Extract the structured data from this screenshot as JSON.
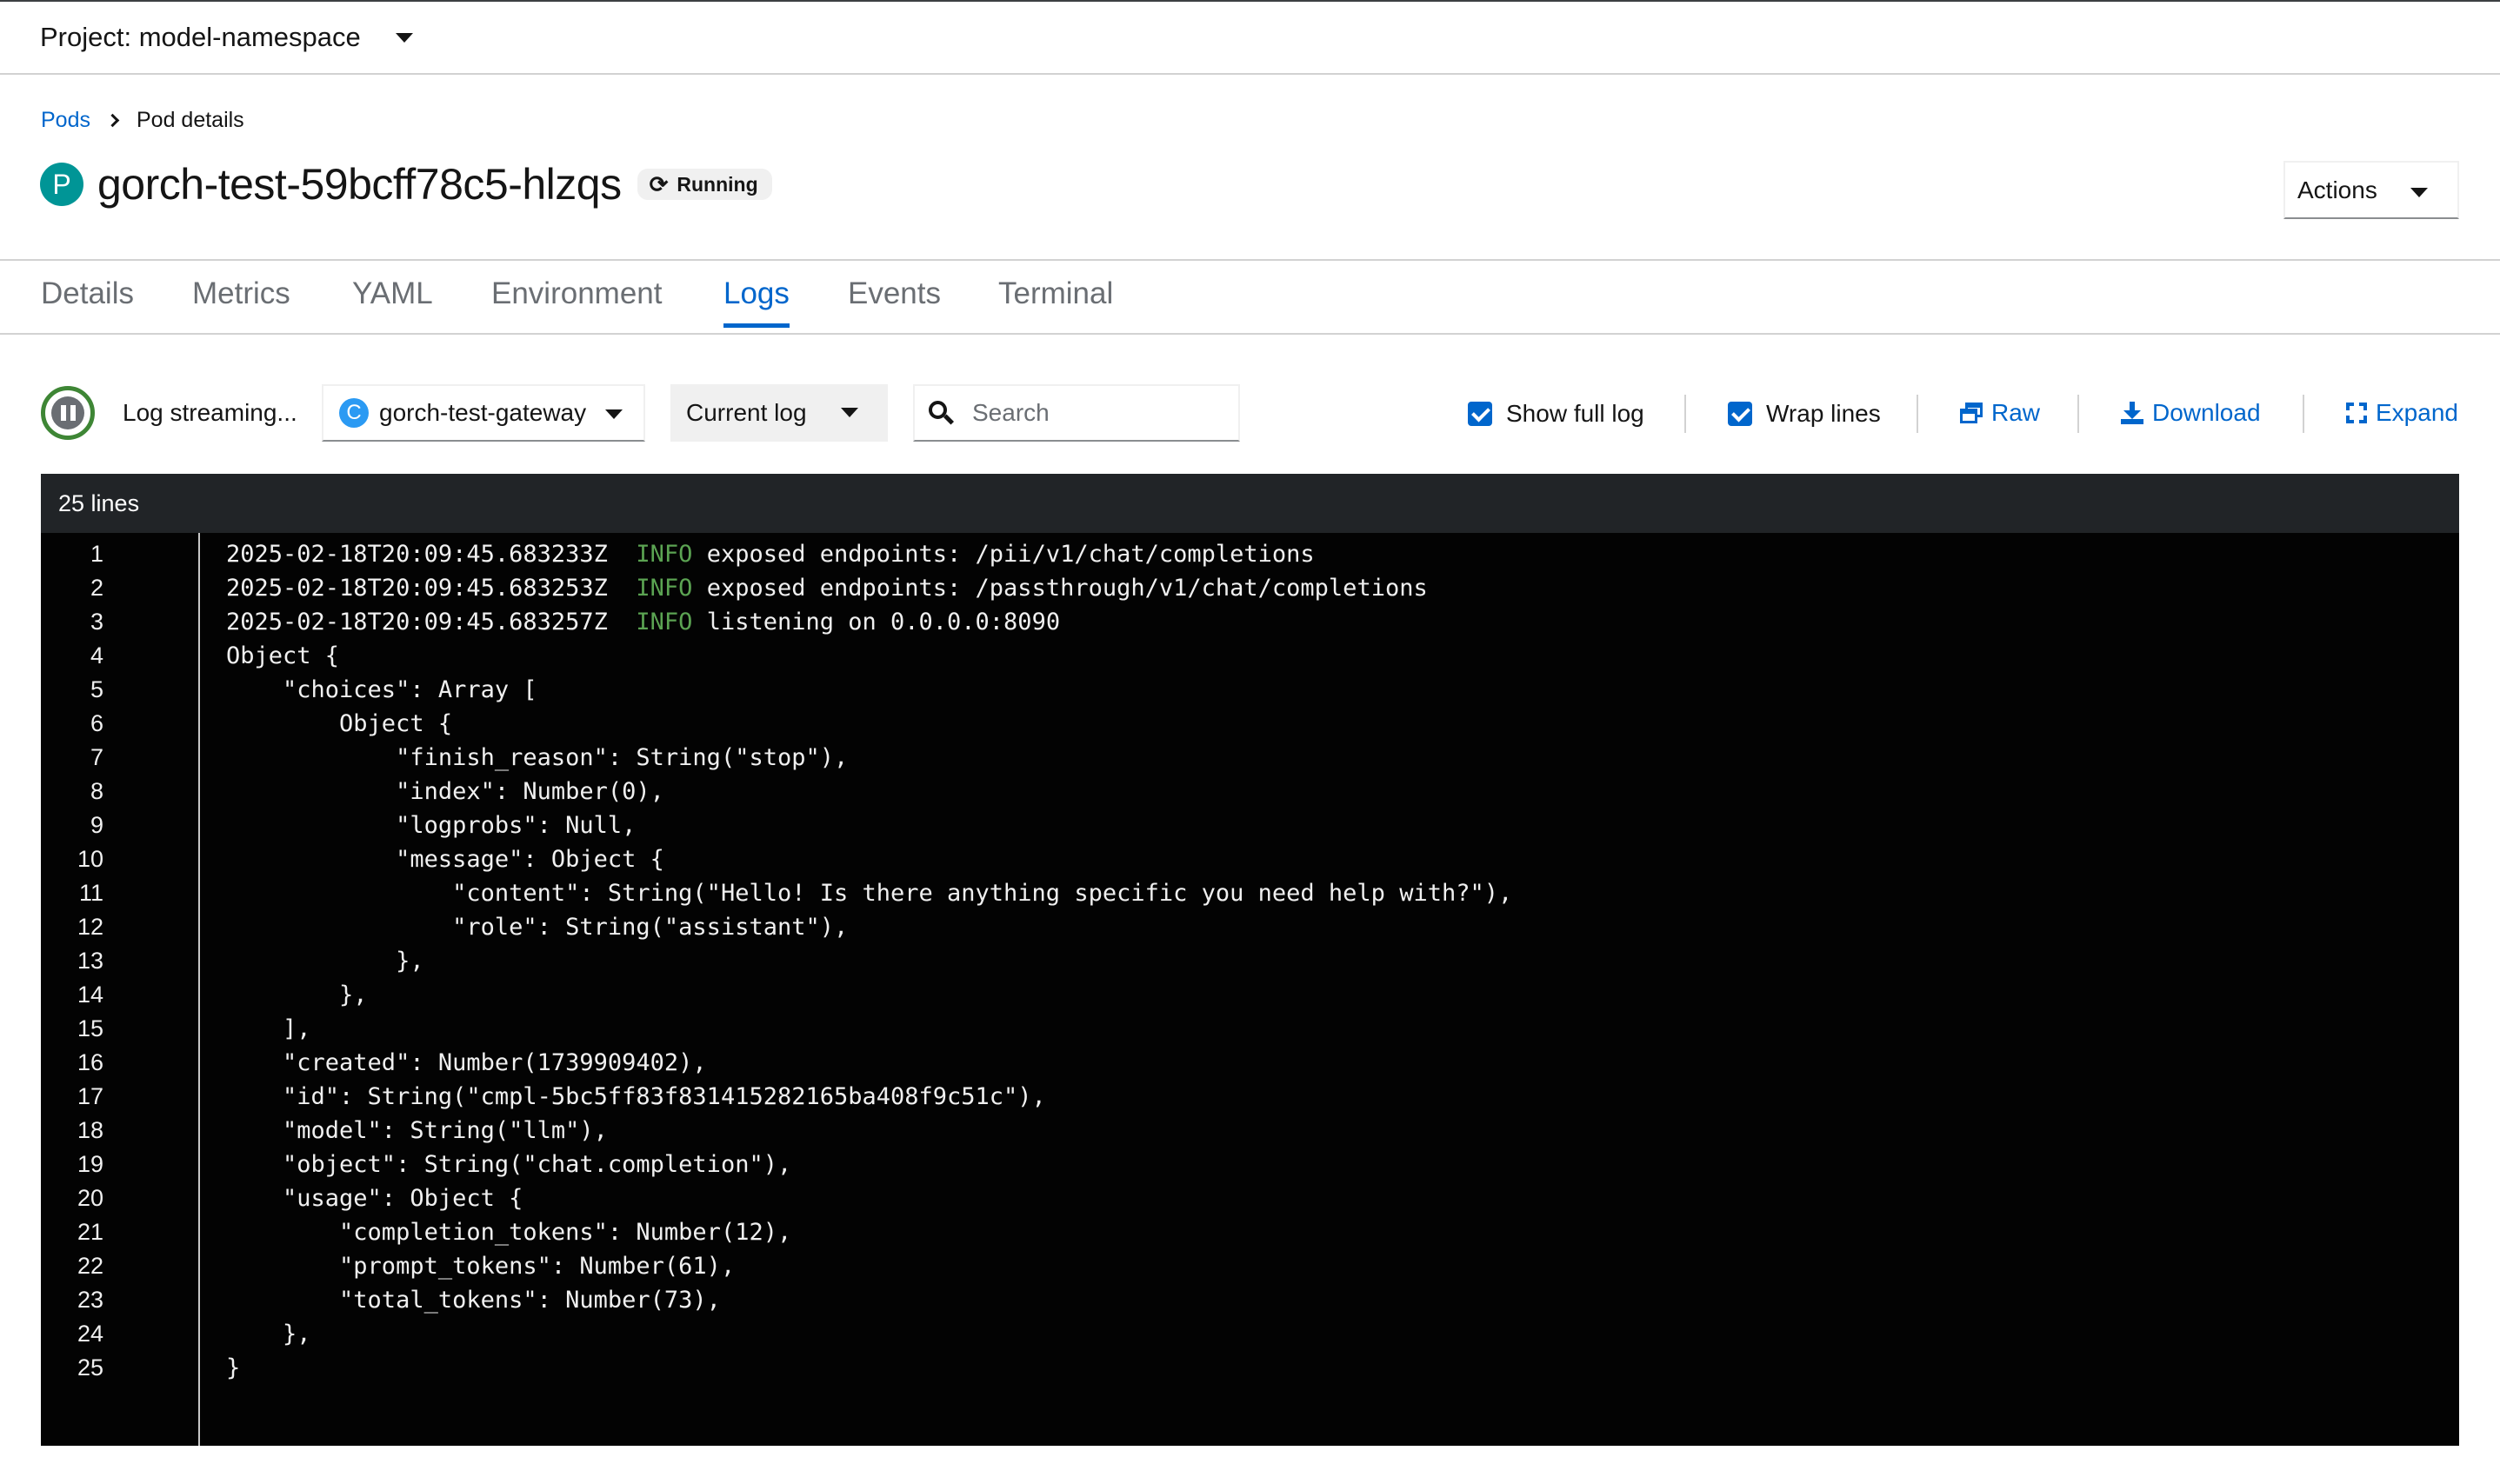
{
  "project": {
    "label": "Project: model-namespace"
  },
  "breadcrumb": {
    "parent": "Pods",
    "current": "Pod details"
  },
  "pod": {
    "badge": "P",
    "name": "gorch-test-59bcff78c5-hlzqs",
    "status": "Running"
  },
  "actions": {
    "label": "Actions"
  },
  "tabs": [
    {
      "label": "Details"
    },
    {
      "label": "Metrics"
    },
    {
      "label": "YAML"
    },
    {
      "label": "Environment"
    },
    {
      "label": "Logs",
      "active": true
    },
    {
      "label": "Events"
    },
    {
      "label": "Terminal"
    }
  ],
  "toolbar": {
    "streaming_label": "Log streaming...",
    "container_badge": "C",
    "container": "gorch-test-gateway",
    "log_type": "Current log",
    "search_placeholder": "Search",
    "show_full_log": "Show full log",
    "wrap_lines": "Wrap lines",
    "raw": "Raw",
    "download": "Download",
    "expand": "Expand"
  },
  "log": {
    "line_count": "25 lines",
    "lines": [
      {
        "n": "1",
        "ts": "2025-02-18T20:09:45.683233Z  ",
        "level": "INFO",
        "text": " exposed endpoints: /pii/v1/chat/completions"
      },
      {
        "n": "2",
        "ts": "2025-02-18T20:09:45.683253Z  ",
        "level": "INFO",
        "text": " exposed endpoints: /passthrough/v1/chat/completions"
      },
      {
        "n": "3",
        "ts": "2025-02-18T20:09:45.683257Z  ",
        "level": "INFO",
        "text": " listening on 0.0.0.0:8090"
      },
      {
        "n": "4",
        "text": "Object {"
      },
      {
        "n": "5",
        "text": "    \"choices\": Array ["
      },
      {
        "n": "6",
        "text": "        Object {"
      },
      {
        "n": "7",
        "text": "            \"finish_reason\": String(\"stop\"),"
      },
      {
        "n": "8",
        "text": "            \"index\": Number(0),"
      },
      {
        "n": "9",
        "text": "            \"logprobs\": Null,"
      },
      {
        "n": "10",
        "text": "            \"message\": Object {"
      },
      {
        "n": "11",
        "text": "                \"content\": String(\"Hello! Is there anything specific you need help with?\"),"
      },
      {
        "n": "12",
        "text": "                \"role\": String(\"assistant\"),"
      },
      {
        "n": "13",
        "text": "            },"
      },
      {
        "n": "14",
        "text": "        },"
      },
      {
        "n": "15",
        "text": "    ],"
      },
      {
        "n": "16",
        "text": "    \"created\": Number(1739909402),"
      },
      {
        "n": "17",
        "text": "    \"id\": String(\"cmpl-5bc5ff83f831415282165ba408f9c51c\"),"
      },
      {
        "n": "18",
        "text": "    \"model\": String(\"llm\"),"
      },
      {
        "n": "19",
        "text": "    \"object\": String(\"chat.completion\"),"
      },
      {
        "n": "20",
        "text": "    \"usage\": Object {"
      },
      {
        "n": "21",
        "text": "        \"completion_tokens\": Number(12),"
      },
      {
        "n": "22",
        "text": "        \"prompt_tokens\": Number(61),"
      },
      {
        "n": "23",
        "text": "        \"total_tokens\": Number(73),"
      },
      {
        "n": "24",
        "text": "    },"
      },
      {
        "n": "25",
        "text": "}"
      }
    ]
  }
}
